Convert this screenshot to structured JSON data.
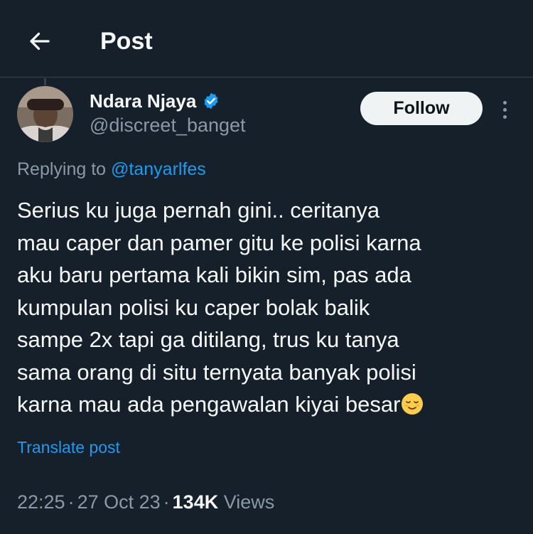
{
  "header": {
    "title": "Post",
    "back_icon": "arrow-left-icon"
  },
  "author": {
    "display_name": "Ndara Njaya",
    "handle": "@discreet_banget",
    "verified_icon": "verified-badge-icon",
    "verified_color": "#1d9bf0"
  },
  "actions": {
    "follow_label": "Follow",
    "more_icon": "more-vertical-icon"
  },
  "reply_context": {
    "prefix": "Replying to ",
    "mention": "@tanyarlfes"
  },
  "post": {
    "lines": [
      "Serius ku juga pernah gini.. ceritanya",
      "mau caper dan pamer gitu ke polisi karna",
      "aku baru pertama kali bikin sim, pas ada",
      "kumpulan polisi ku caper bolak balik",
      "sampe 2x tapi ga ditilang, trus ku tanya",
      "sama orang di situ ternyata banyak polisi",
      "karna mau ada pengawalan kiyai besar"
    ],
    "emoji": "relieved-face-emoji",
    "translate_label": "Translate post"
  },
  "meta": {
    "time": "22:25",
    "date": "27 Oct 23",
    "separator": "·",
    "views_count": "134K",
    "views_label": "Views"
  },
  "colors": {
    "background": "#15202b",
    "text": "#f7f9f9",
    "secondary_text": "#8b98a5",
    "accent": "#1d9bf0",
    "divider": "#38444d"
  }
}
